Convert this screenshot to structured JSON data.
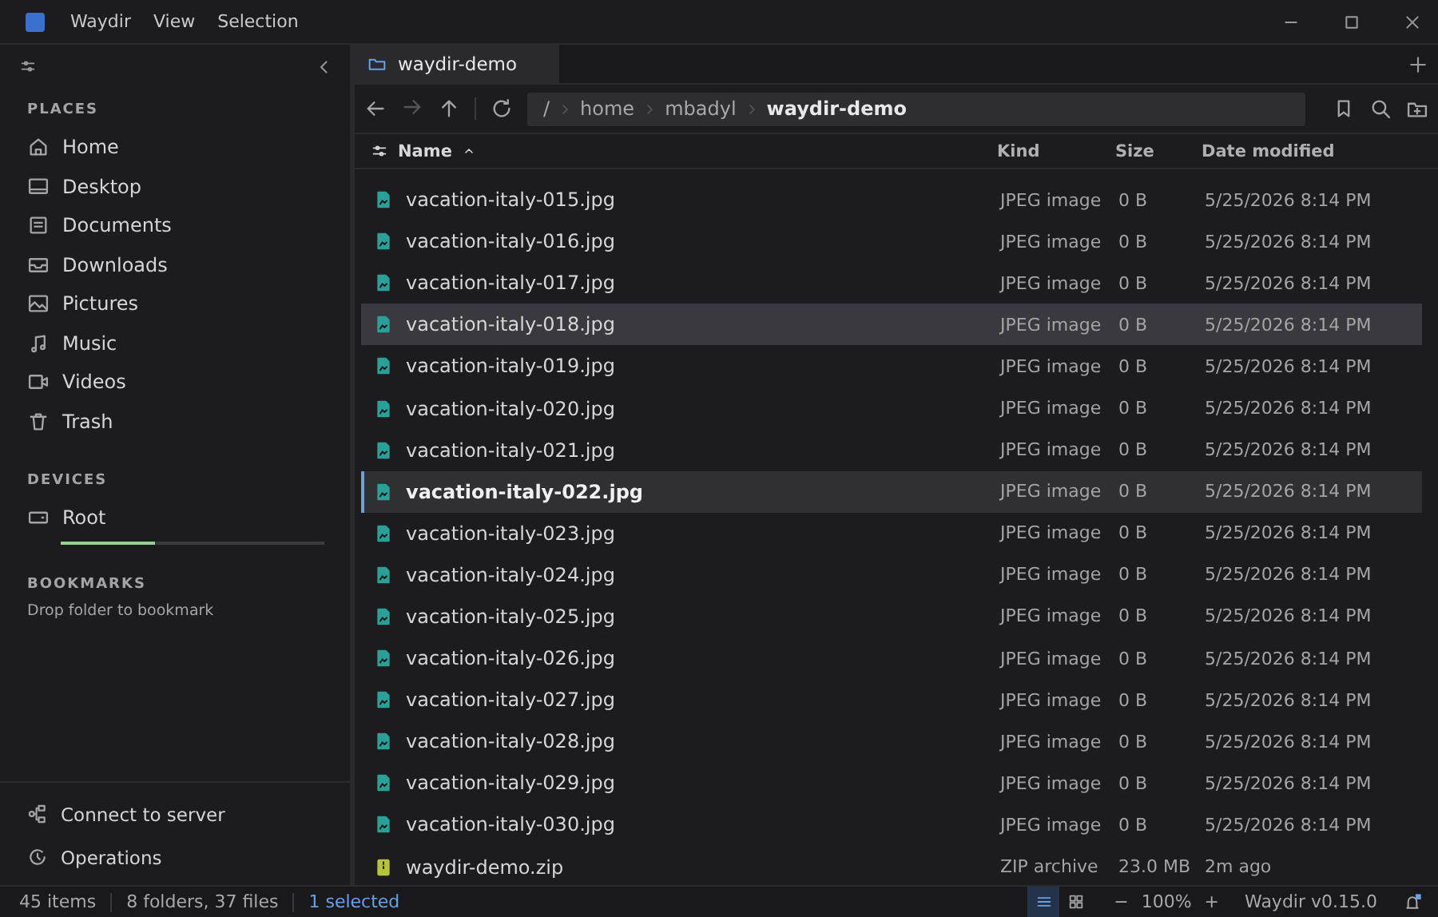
{
  "window": {
    "app_menu": [
      "Waydir",
      "View",
      "Selection"
    ]
  },
  "sidebar": {
    "sections": [
      {
        "title": "PLACES",
        "items": [
          {
            "label": "Home",
            "kind": "home"
          },
          {
            "label": "Desktop",
            "kind": "desktop"
          },
          {
            "label": "Documents",
            "kind": "documents"
          },
          {
            "label": "Downloads",
            "kind": "downloads"
          },
          {
            "label": "Pictures",
            "kind": "pictures"
          },
          {
            "label": "Music",
            "kind": "music"
          },
          {
            "label": "Videos",
            "kind": "videos"
          },
          {
            "label": "Trash",
            "kind": "trash"
          }
        ]
      },
      {
        "title": "DEVICES",
        "devices": [
          {
            "label": "Root",
            "level": 0.36
          }
        ]
      },
      {
        "title": "BOOKMARKS",
        "hint": "Drop folder to bookmark"
      }
    ],
    "footer": [
      {
        "label": "Connect to server",
        "kind": "network"
      },
      {
        "label": "Operations",
        "kind": "operations"
      }
    ]
  },
  "tabs": [
    {
      "label": "waydir-demo",
      "selected": true
    }
  ],
  "breadcrumb": [
    "/",
    "home",
    "mbadyl",
    "waydir-demo"
  ],
  "table": {
    "columns": [
      "Name",
      "Kind",
      "Size",
      "Date modified"
    ],
    "rows": [
      {
        "name": "vacation-italy-015.jpg",
        "file_kind": "JPEG image",
        "size": "0 B",
        "date": "5/25/2026 8:14 PM",
        "kind": "image",
        "selected": false,
        "hovered": false
      },
      {
        "name": "vacation-italy-016.jpg",
        "file_kind": "JPEG image",
        "size": "0 B",
        "date": "5/25/2026 8:14 PM",
        "kind": "image",
        "selected": false,
        "hovered": false
      },
      {
        "name": "vacation-italy-017.jpg",
        "file_kind": "JPEG image",
        "size": "0 B",
        "date": "5/25/2026 8:14 PM",
        "kind": "image",
        "selected": false,
        "hovered": false
      },
      {
        "name": "vacation-italy-018.jpg",
        "file_kind": "JPEG image",
        "size": "0 B",
        "date": "5/25/2026 8:14 PM",
        "kind": "image",
        "selected": false,
        "hovered": true
      },
      {
        "name": "vacation-italy-019.jpg",
        "file_kind": "JPEG image",
        "size": "0 B",
        "date": "5/25/2026 8:14 PM",
        "kind": "image",
        "selected": false,
        "hovered": false
      },
      {
        "name": "vacation-italy-020.jpg",
        "file_kind": "JPEG image",
        "size": "0 B",
        "date": "5/25/2026 8:14 PM",
        "kind": "image",
        "selected": false,
        "hovered": false
      },
      {
        "name": "vacation-italy-021.jpg",
        "file_kind": "JPEG image",
        "size": "0 B",
        "date": "5/25/2026 8:14 PM",
        "kind": "image",
        "selected": false,
        "hovered": false
      },
      {
        "name": "vacation-italy-022.jpg",
        "file_kind": "JPEG image",
        "size": "0 B",
        "date": "5/25/2026 8:14 PM",
        "kind": "image",
        "selected": true,
        "hovered": false
      },
      {
        "name": "vacation-italy-023.jpg",
        "file_kind": "JPEG image",
        "size": "0 B",
        "date": "5/25/2026 8:14 PM",
        "kind": "image",
        "selected": false,
        "hovered": false
      },
      {
        "name": "vacation-italy-024.jpg",
        "file_kind": "JPEG image",
        "size": "0 B",
        "date": "5/25/2026 8:14 PM",
        "kind": "image",
        "selected": false,
        "hovered": false
      },
      {
        "name": "vacation-italy-025.jpg",
        "file_kind": "JPEG image",
        "size": "0 B",
        "date": "5/25/2026 8:14 PM",
        "kind": "image",
        "selected": false,
        "hovered": false
      },
      {
        "name": "vacation-italy-026.jpg",
        "file_kind": "JPEG image",
        "size": "0 B",
        "date": "5/25/2026 8:14 PM",
        "kind": "image",
        "selected": false,
        "hovered": false
      },
      {
        "name": "vacation-italy-027.jpg",
        "file_kind": "JPEG image",
        "size": "0 B",
        "date": "5/25/2026 8:14 PM",
        "kind": "image",
        "selected": false,
        "hovered": false
      },
      {
        "name": "vacation-italy-028.jpg",
        "file_kind": "JPEG image",
        "size": "0 B",
        "date": "5/25/2026 8:14 PM",
        "kind": "image",
        "selected": false,
        "hovered": false
      },
      {
        "name": "vacation-italy-029.jpg",
        "file_kind": "JPEG image",
        "size": "0 B",
        "date": "5/25/2026 8:14 PM",
        "kind": "image",
        "selected": false,
        "hovered": false
      },
      {
        "name": "vacation-italy-030.jpg",
        "file_kind": "JPEG image",
        "size": "0 B",
        "date": "5/25/2026 8:14 PM",
        "kind": "image",
        "selected": false,
        "hovered": false
      },
      {
        "name": "waydir-demo.zip",
        "file_kind": "ZIP archive",
        "size": "23.0 MB",
        "date": "2m ago",
        "kind": "archive",
        "selected": false,
        "hovered": false
      }
    ]
  },
  "status_bar": {
    "counts": [
      "45 items",
      "8 folders, 37 files"
    ],
    "selection": "1 selected",
    "view_modes": [
      {
        "kind": "list",
        "selected": true
      },
      {
        "kind": "grid",
        "selected": false
      }
    ],
    "zoom": {
      "minus": "−",
      "value": "100%",
      "plus": "+"
    },
    "version": "Waydir v0.15.0"
  }
}
